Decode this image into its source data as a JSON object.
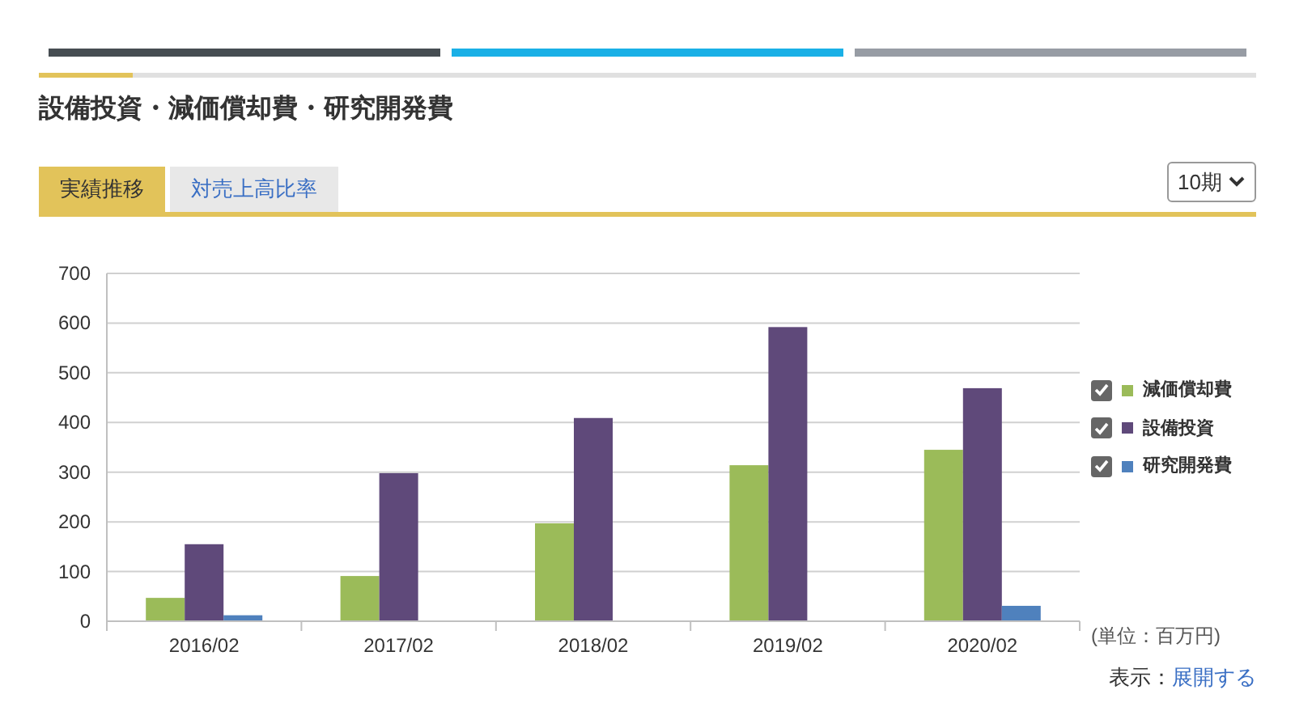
{
  "section_bars": [
    {
      "color": "#464d52"
    },
    {
      "color": "#1ab0e6"
    },
    {
      "color": "#979ca4"
    }
  ],
  "title": "設備投資・減価償却費・研究開発費",
  "tabs": [
    {
      "label": "実績推移",
      "selected": true
    },
    {
      "label": "対売上高比率",
      "selected": false
    }
  ],
  "period_select": {
    "value": "10期"
  },
  "chart": {
    "chart_data": {
      "type": "bar",
      "categories": [
        "2016/02",
        "2017/02",
        "2018/02",
        "2019/02",
        "2020/02"
      ],
      "ylim": [
        0,
        700
      ],
      "yticks": [
        0,
        100,
        200,
        300,
        400,
        500,
        600,
        700
      ],
      "series": [
        {
          "name": "減価償却費",
          "color": "#9bbb59",
          "values": [
            47,
            91,
            197,
            314,
            345
          ]
        },
        {
          "name": "設備投資",
          "color": "#5f497a",
          "values": [
            155,
            298,
            409,
            592,
            469
          ]
        },
        {
          "name": "研究開発費",
          "color": "#4f81bd",
          "values": [
            12,
            null,
            null,
            null,
            31
          ]
        }
      ],
      "grid": true
    },
    "legend": [
      {
        "checked": true
      },
      {
        "checked": true
      },
      {
        "checked": true
      }
    ],
    "unit": "(単位：百万円)"
  },
  "display": {
    "label": "表示：",
    "link": "展開する"
  }
}
